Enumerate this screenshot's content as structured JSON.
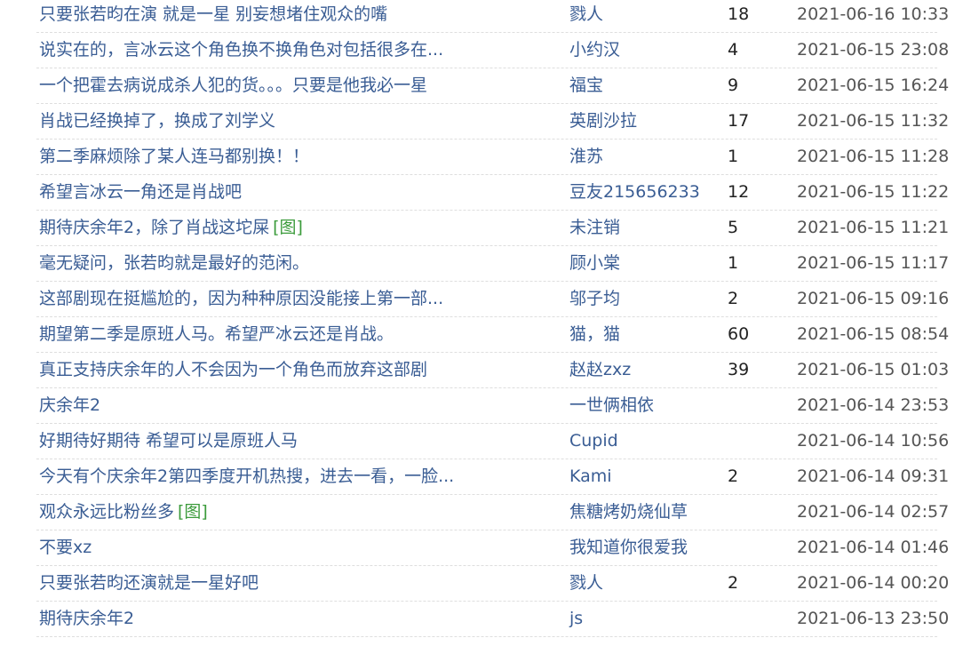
{
  "rows": [
    {
      "title": "只要张若昀在演 就是一星 别妄想堵住观众的嘴",
      "img": "",
      "author": "戮人",
      "count": "18",
      "time": "2021-06-16 10:33"
    },
    {
      "title": "说实在的，言冰云这个角色换不换角色对包括很多在...",
      "img": "",
      "author": "小约汉",
      "count": "4",
      "time": "2021-06-15 23:08"
    },
    {
      "title": "一个把霍去病说成杀人犯的货。。。只要是他我必一星",
      "img": "",
      "author": "福宝",
      "count": "9",
      "time": "2021-06-15 16:24"
    },
    {
      "title": "肖战已经换掉了，换成了刘学义",
      "img": "",
      "author": "英剧沙拉",
      "count": "17",
      "time": "2021-06-15 11:32"
    },
    {
      "title": "第二季麻烦除了某人连马都别换！！",
      "img": "",
      "author": "淮苏",
      "count": "1",
      "time": "2021-06-15 11:28"
    },
    {
      "title": "希望言冰云一角还是肖战吧",
      "img": "",
      "author": "豆友215656233",
      "count": "12",
      "time": "2021-06-15 11:22"
    },
    {
      "title": "期待庆余年2，除了肖战这坨屎",
      "img": "[图]",
      "author": "未注销",
      "count": "5",
      "time": "2021-06-15 11:21"
    },
    {
      "title": "毫无疑问，张若昀就是最好的范闲。",
      "img": "",
      "author": "顾小棠",
      "count": "1",
      "time": "2021-06-15 11:17"
    },
    {
      "title": "这部剧现在挺尴尬的，因为种种原因没能接上第一部...",
      "img": "",
      "author": "邬子均",
      "count": "2",
      "time": "2021-06-15 09:16"
    },
    {
      "title": "期望第二季是原班人马。希望严冰云还是肖战。",
      "img": "",
      "author": "猫，猫",
      "count": "60",
      "time": "2021-06-15 08:54"
    },
    {
      "title": "真正支持庆余年的人不会因为一个角色而放弃这部剧",
      "img": "",
      "author": "赵赵zxz",
      "count": "39",
      "time": "2021-06-15 01:03"
    },
    {
      "title": "庆余年2",
      "img": "",
      "author": "一世俩相依",
      "count": "",
      "time": "2021-06-14 23:53"
    },
    {
      "title": "好期待好期待 希望可以是原班人马",
      "img": "",
      "author": "Cupid",
      "count": "",
      "time": "2021-06-14 10:56"
    },
    {
      "title": "今天有个庆余年2第四季度开机热搜，进去一看，一脸...",
      "img": "",
      "author": "Kami",
      "count": "2",
      "time": "2021-06-14 09:31"
    },
    {
      "title": "观众永远比粉丝多",
      "img": "[图]",
      "author": "焦糖烤奶烧仙草",
      "count": "",
      "time": "2021-06-14 02:57"
    },
    {
      "title": "不要xz",
      "img": "",
      "author": "我知道你很爱我",
      "count": "",
      "time": "2021-06-14 01:46"
    },
    {
      "title": "只要张若昀还演就是一星好吧",
      "img": "",
      "author": "戮人",
      "count": "2",
      "time": "2021-06-14 00:20"
    },
    {
      "title": "期待庆余年2",
      "img": "",
      "author": "js",
      "count": "",
      "time": "2021-06-13 23:50"
    }
  ],
  "colors": {
    "link": "#3a5d94",
    "image_tag": "#3b9b3b",
    "time": "#555555",
    "divider": "#dedede"
  }
}
